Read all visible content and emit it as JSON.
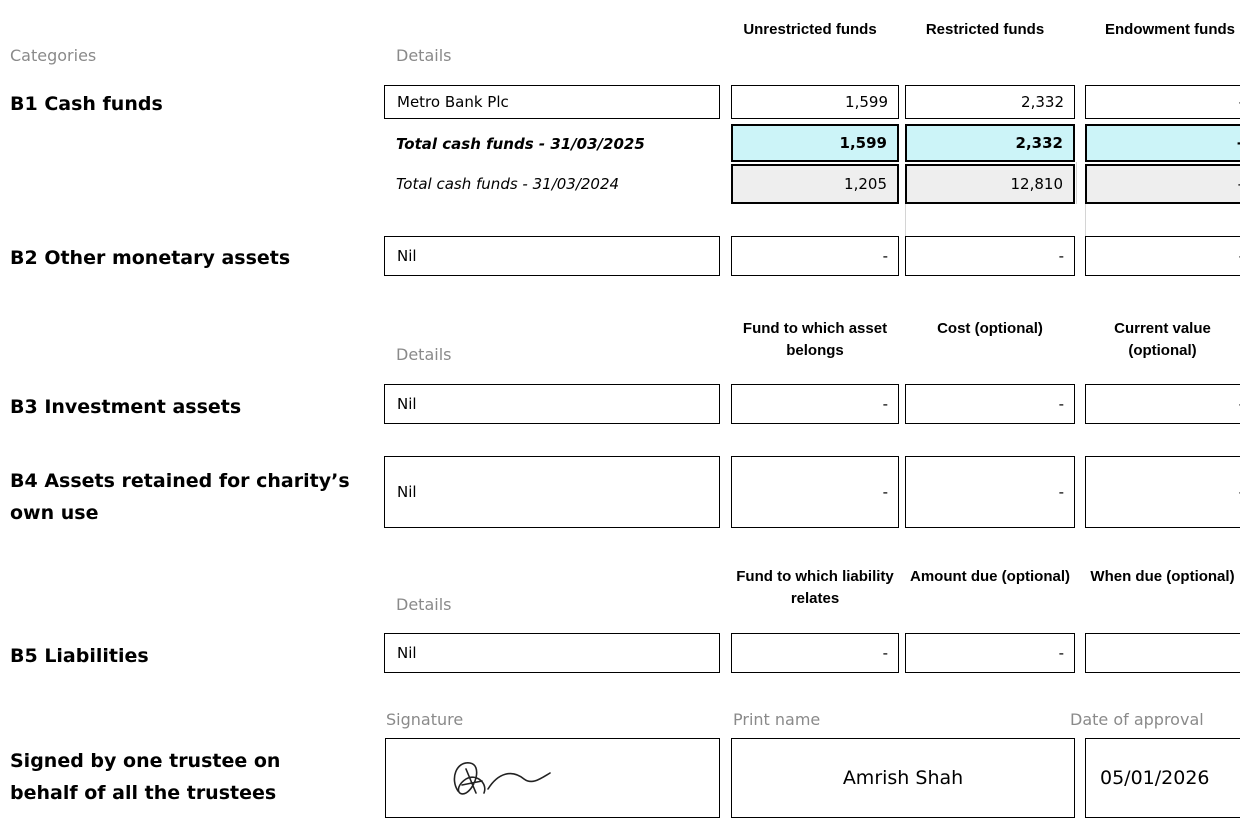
{
  "headers": {
    "categories": "Categories",
    "details": "Details",
    "unrestricted": "Unrestricted funds",
    "restricted": "Restricted funds",
    "endowment": "Endowment funds",
    "fund_asset": "Fund to which asset belongs",
    "cost": "Cost (optional)",
    "current_value": "Current value (optional)",
    "fund_liability": "Fund to which liability relates",
    "amount_due": "Amount due (optional)",
    "when_due": "When due (optional)"
  },
  "b1": {
    "label": "B1 Cash funds",
    "detail": "Metro Bank Plc",
    "unrestricted": "1,599",
    "restricted": "2,332",
    "endowment": "-",
    "total_2025_label": "Total cash funds - 31/03/2025",
    "total_2025_unrestricted": "1,599",
    "total_2025_restricted": "2,332",
    "total_2025_endowment": "-",
    "total_2024_label": "Total cash funds - 31/03/2024",
    "total_2024_unrestricted": "1,205",
    "total_2024_restricted": "12,810",
    "total_2024_endowment": "-"
  },
  "b2": {
    "label": "B2 Other monetary assets",
    "detail": "Nil",
    "c1": "-",
    "c2": "-",
    "c3": "-"
  },
  "b3": {
    "label": "B3 Investment assets",
    "detail": "Nil",
    "c1": "-",
    "c2": "-",
    "c3": "-"
  },
  "b4": {
    "label_line1": "B4 Assets retained for charity’s",
    "label_line2": "own use",
    "detail": "Nil",
    "c1": "-",
    "c2": "-",
    "c3": "-"
  },
  "b5": {
    "label": "B5 Liabilities",
    "detail": "Nil",
    "c1": "-",
    "c2": "-",
    "c3": ""
  },
  "signoff": {
    "label_line1": "Signed by one trustee on",
    "label_line2": "behalf of all the trustees",
    "signature_header": "Signature",
    "print_name_header": "Print name",
    "date_header": "Date of approval",
    "print_name": "Amrish Shah",
    "date": "05/01/2026"
  }
}
